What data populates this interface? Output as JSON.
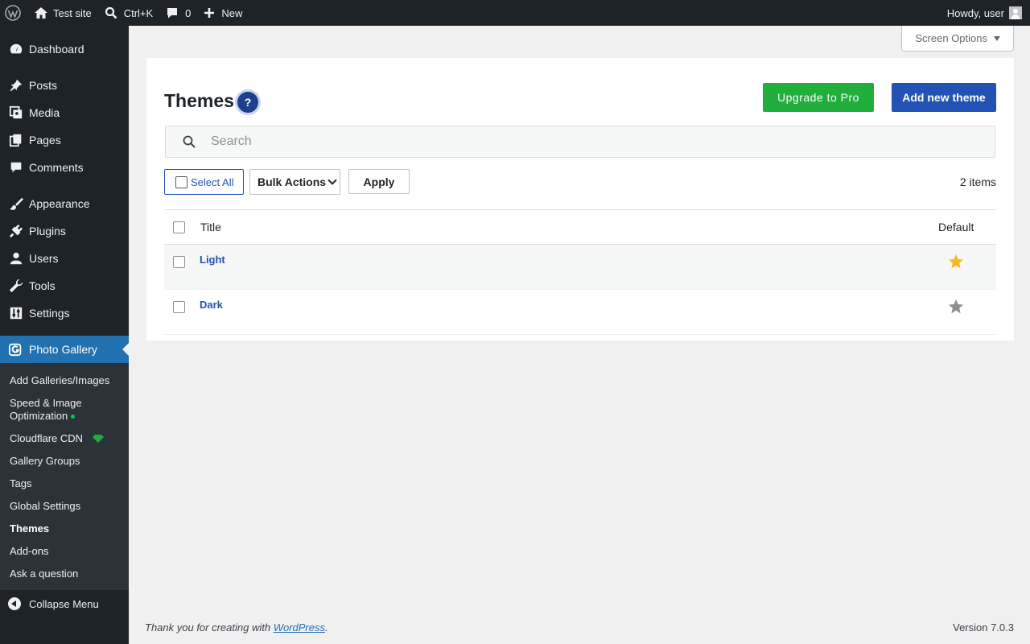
{
  "adminbar": {
    "site_name": "Test site",
    "search_shortcut": "Ctrl+K",
    "comments_count": "0",
    "new_label": "New",
    "howdy": "Howdy, user"
  },
  "sidebar": {
    "items": [
      {
        "label": "Dashboard",
        "icon": "dashboard-icon"
      },
      {
        "label": "Posts",
        "icon": "pin-icon"
      },
      {
        "label": "Media",
        "icon": "media-icon"
      },
      {
        "label": "Pages",
        "icon": "pages-icon"
      },
      {
        "label": "Comments",
        "icon": "comment-icon"
      },
      {
        "label": "Appearance",
        "icon": "brush-icon"
      },
      {
        "label": "Plugins",
        "icon": "plug-icon"
      },
      {
        "label": "Users",
        "icon": "user-icon"
      },
      {
        "label": "Tools",
        "icon": "wrench-icon"
      },
      {
        "label": "Settings",
        "icon": "sliders-icon"
      },
      {
        "label": "Photo Gallery",
        "icon": "gallery-icon"
      }
    ],
    "submenu": [
      "Add Galleries/Images",
      "Speed & Image Optimization",
      "Cloudflare CDN",
      "Gallery Groups",
      "Tags",
      "Global Settings",
      "Themes",
      "Add-ons",
      "Ask a question"
    ],
    "collapse_label": "Collapse Menu"
  },
  "screen_options": "Screen Options",
  "page": {
    "title": "Themes",
    "help": "?",
    "upgrade_button": "Upgrade to Pro",
    "add_button": "Add new theme",
    "search_placeholder": "Search",
    "select_all": "Select All",
    "bulk_actions": "Bulk Actions",
    "apply": "Apply",
    "items_count": "2 items"
  },
  "table": {
    "headers": {
      "title": "Title",
      "default": "Default"
    },
    "rows": [
      {
        "title": "Light",
        "is_default": true
      },
      {
        "title": "Dark",
        "is_default": false
      }
    ]
  },
  "colors": {
    "star_active": "#f5b921",
    "star_inactive": "#8c8f94",
    "accent_blue": "#2253b4",
    "upgrade_green": "#22ae3c"
  },
  "footer": {
    "thanks_prefix": "Thank you for creating with ",
    "thanks_link": "WordPress",
    "thanks_suffix": ".",
    "version": "Version 7.0.3"
  }
}
